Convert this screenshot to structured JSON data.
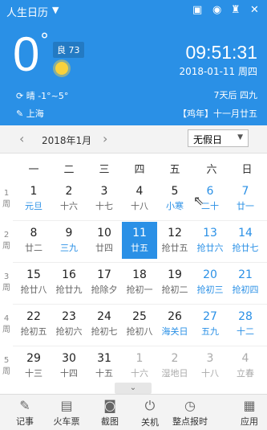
{
  "header": {
    "app_title": "人生日历",
    "temperature": "0",
    "degree": "°",
    "air_quality": "良 73",
    "weather": "晴 -1°~5°",
    "city": "上海",
    "time": "09:51:31",
    "date": "2018-01-11 周四",
    "lunar_info": "7天后 四九",
    "lunar_date": "【鸡年】十一月廿五",
    "colors": {
      "bg": "#2a90e6",
      "sun": "#f8d23d"
    }
  },
  "nav": {
    "month": "2018年1月",
    "holiday_option": "无假日"
  },
  "weekdays": [
    "一",
    "二",
    "三",
    "四",
    "五",
    "六",
    "日"
  ],
  "weeks": [
    {
      "label": "1周",
      "days": [
        {
          "num": "1",
          "sub": "元旦",
          "type": "holiday"
        },
        {
          "num": "2",
          "sub": "十六",
          "type": "normal"
        },
        {
          "num": "3",
          "sub": "十七",
          "type": "normal"
        },
        {
          "num": "4",
          "sub": "十八",
          "type": "normal"
        },
        {
          "num": "5",
          "sub": "小寒",
          "type": "holiday"
        },
        {
          "num": "6",
          "sub": "二十",
          "type": "weekend"
        },
        {
          "num": "7",
          "sub": "廿一",
          "type": "weekend"
        }
      ]
    },
    {
      "label": "2周",
      "days": [
        {
          "num": "8",
          "sub": "廿二",
          "type": "normal"
        },
        {
          "num": "9",
          "sub": "三九",
          "type": "holiday"
        },
        {
          "num": "10",
          "sub": "廿四",
          "type": "normal"
        },
        {
          "num": "11",
          "sub": "廿五",
          "type": "selected"
        },
        {
          "num": "12",
          "sub": "抢廿五",
          "type": "normal"
        },
        {
          "num": "13",
          "sub": "抢廿六",
          "type": "weekend"
        },
        {
          "num": "14",
          "sub": "抢廿七",
          "type": "weekend"
        }
      ]
    },
    {
      "label": "3周",
      "days": [
        {
          "num": "15",
          "sub": "抢廿八",
          "type": "normal"
        },
        {
          "num": "16",
          "sub": "抢廿九",
          "type": "normal"
        },
        {
          "num": "17",
          "sub": "抢除夕",
          "type": "normal"
        },
        {
          "num": "18",
          "sub": "抢初一",
          "type": "normal"
        },
        {
          "num": "19",
          "sub": "抢初二",
          "type": "normal"
        },
        {
          "num": "20",
          "sub": "抢初三",
          "type": "weekend"
        },
        {
          "num": "21",
          "sub": "抢初四",
          "type": "weekend"
        }
      ]
    },
    {
      "label": "4周",
      "days": [
        {
          "num": "22",
          "sub": "抢初五",
          "type": "normal"
        },
        {
          "num": "23",
          "sub": "抢初六",
          "type": "normal"
        },
        {
          "num": "24",
          "sub": "抢初七",
          "type": "normal"
        },
        {
          "num": "25",
          "sub": "抢初八",
          "type": "normal"
        },
        {
          "num": "26",
          "sub": "海关日",
          "type": "holiday"
        },
        {
          "num": "27",
          "sub": "五九",
          "type": "weekend"
        },
        {
          "num": "28",
          "sub": "十二",
          "type": "weekend"
        }
      ]
    },
    {
      "label": "5周",
      "days": [
        {
          "num": "29",
          "sub": "十三",
          "type": "normal"
        },
        {
          "num": "30",
          "sub": "十四",
          "type": "normal"
        },
        {
          "num": "31",
          "sub": "十五",
          "type": "normal"
        },
        {
          "num": "1",
          "sub": "十六",
          "type": "other"
        },
        {
          "num": "2",
          "sub": "湿地日",
          "type": "other"
        },
        {
          "num": "3",
          "sub": "十八",
          "type": "other"
        },
        {
          "num": "4",
          "sub": "立春",
          "type": "other"
        }
      ]
    }
  ],
  "toolbar": [
    {
      "label": "记事",
      "icon": "note-icon"
    },
    {
      "label": "火车票",
      "icon": "train-icon"
    },
    {
      "label": "截图",
      "icon": "camera-icon"
    },
    {
      "label": "关机",
      "icon": "power-icon"
    },
    {
      "label": "整点报时",
      "icon": "clock-icon"
    },
    {
      "label": "应用",
      "icon": "apps-icon"
    }
  ],
  "collapse_label": "⌄"
}
